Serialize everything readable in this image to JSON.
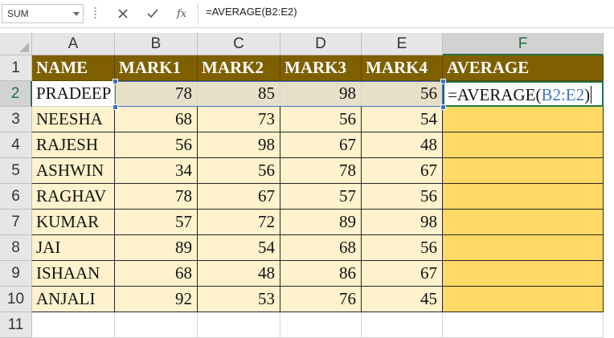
{
  "formula_bar": {
    "name_box": "SUM",
    "cancel_icon": "close-icon",
    "enter_icon": "check-icon",
    "fx_label": "fx",
    "formula": "=AVERAGE(B2:E2)"
  },
  "columns": [
    "A",
    "B",
    "C",
    "D",
    "E",
    "F"
  ],
  "rows": [
    "1",
    "2",
    "3",
    "4",
    "5",
    "6",
    "7",
    "8",
    "9",
    "10",
    "11"
  ],
  "header": [
    "NAME",
    "MARK1",
    "MARK2",
    "MARK3",
    "MARK4",
    "AVERAGE"
  ],
  "data": [
    [
      "PRADEEP",
      "78",
      "85",
      "98",
      "56"
    ],
    [
      "NEESHA",
      "68",
      "73",
      "56",
      "54"
    ],
    [
      "RAJESH",
      "56",
      "98",
      "67",
      "48"
    ],
    [
      "ASHWIN",
      "34",
      "56",
      "78",
      "67"
    ],
    [
      "RAGHAV",
      "78",
      "67",
      "57",
      "56"
    ],
    [
      "KUMAR",
      "57",
      "72",
      "89",
      "98"
    ],
    [
      "JAI",
      "89",
      "54",
      "68",
      "56"
    ],
    [
      "ISHAAN",
      "68",
      "48",
      "86",
      "67"
    ],
    [
      "ANJALI",
      "92",
      "53",
      "76",
      "45"
    ]
  ],
  "editing_cell": {
    "prefix": "=AVERAGE(",
    "ref": "B2:E2",
    "suffix": ")"
  },
  "colors": {
    "header_fill": "#7f6000",
    "data_fill": "#fff2cc",
    "average_fill": "#ffd966",
    "range_highlight": "#4472c4",
    "active_border": "#217346"
  }
}
